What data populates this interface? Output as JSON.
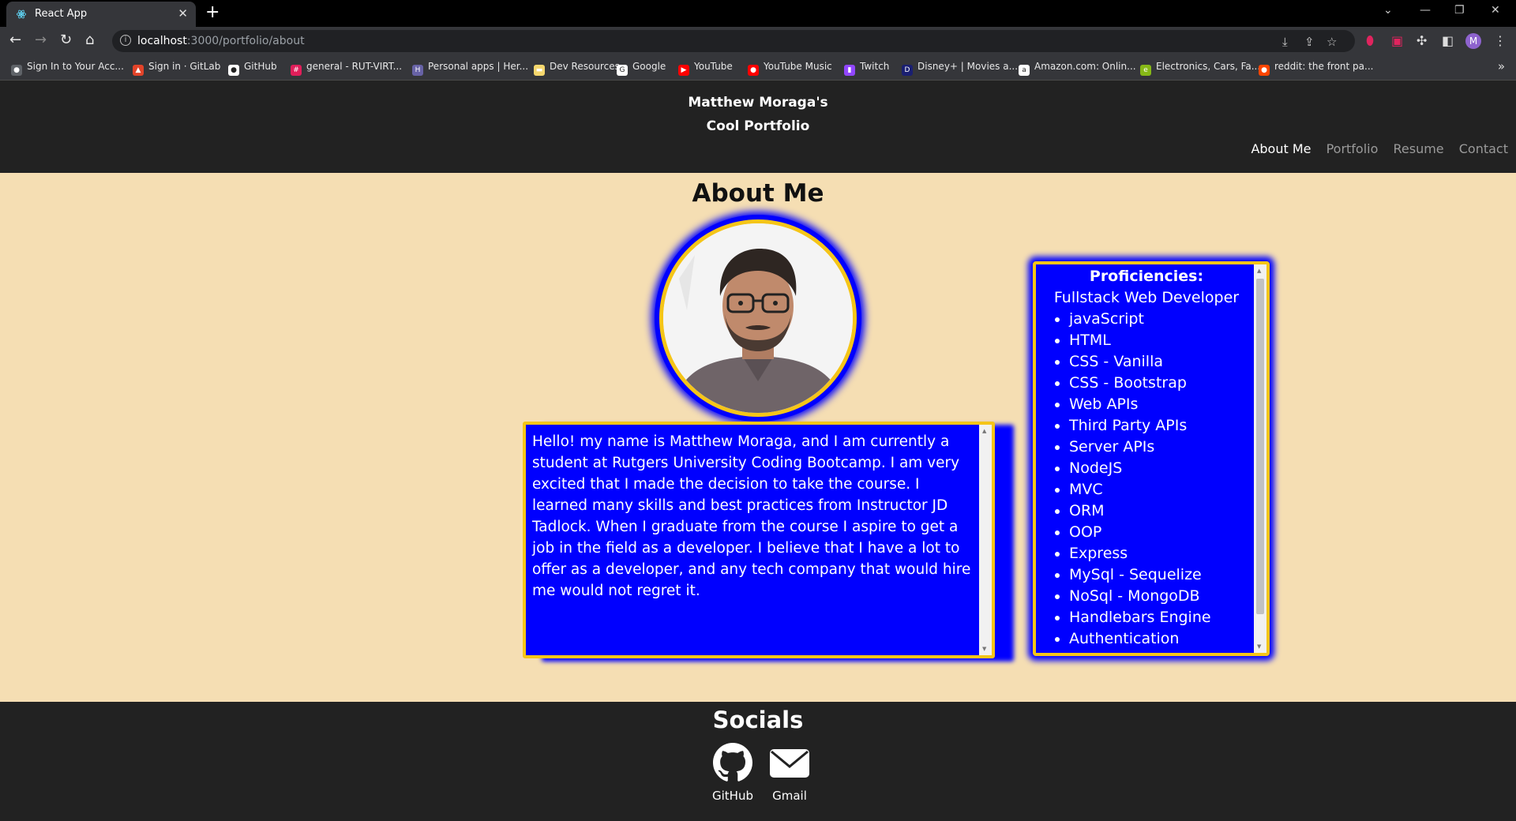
{
  "browser": {
    "tab_title": "React App",
    "url_host": "localhost",
    "url_rest": ":3000/portfolio/about",
    "bookmarks": [
      {
        "label": "Sign In to Your Acc...",
        "icon": "circle-icon",
        "color": "#5f6368"
      },
      {
        "label": "Sign in · GitLab",
        "icon": "gitlab-icon",
        "color": "#e24329"
      },
      {
        "label": "GitHub",
        "icon": "github-icon",
        "color": "#ffffff"
      },
      {
        "label": "general - RUT-VIRT...",
        "icon": "slack-icon",
        "color": "#e01e5a"
      },
      {
        "label": "Personal apps | Her...",
        "icon": "heroku-icon",
        "color": "#6762a6"
      },
      {
        "label": "Dev Resources",
        "icon": "folder-icon",
        "color": "#f5d76e"
      },
      {
        "label": "Google",
        "icon": "google-icon",
        "color": "#ffffff"
      },
      {
        "label": "YouTube",
        "icon": "youtube-icon",
        "color": "#ff0000"
      },
      {
        "label": "YouTube Music",
        "icon": "youtube-music-icon",
        "color": "#ff0000"
      },
      {
        "label": "Twitch",
        "icon": "twitch-icon",
        "color": "#9146ff"
      },
      {
        "label": "Disney+ | Movies a...",
        "icon": "disney-icon",
        "color": "#1a1f71"
      },
      {
        "label": "Amazon.com: Onlin...",
        "icon": "amazon-icon",
        "color": "#ffffff"
      },
      {
        "label": "Electronics, Cars, Fa...",
        "icon": "ebay-icon",
        "color": "#86b817"
      },
      {
        "label": "reddit: the front pa...",
        "icon": "reddit-icon",
        "color": "#ff4500"
      }
    ],
    "avatar_letter": "M"
  },
  "header": {
    "brand_line1": "Matthew Moraga's",
    "brand_line2": "Cool Portfolio",
    "nav": [
      "About Me",
      "Portfolio",
      "Resume",
      "Contact"
    ]
  },
  "main": {
    "title": "About Me",
    "about_text": "Hello! my name is Matthew Moraga, and I am currently a student at Rutgers University Coding Bootcamp. I am very excited that I made the decision to take the course. I learned many skills and best practices from Instructor JD Tadlock. When I graduate from the course I aspire to get a job in the field as a developer. I believe that I have a lot to offer as a developer, and any tech company that would hire me would not regret it.",
    "proficiencies_title": "Proficiencies:",
    "proficiencies_subtitle": "Fullstack Web Developer",
    "proficiencies": [
      "javaScript",
      "HTML",
      "CSS - Vanilla",
      "CSS - Bootstrap",
      "Web APIs",
      "Third Party APIs",
      "Server APIs",
      "NodeJS",
      "MVC",
      "ORM",
      "OOP",
      "Express",
      "MySql - Sequelize",
      "NoSql - MongoDB",
      "Handlebars Engine",
      "Authentication"
    ]
  },
  "footer": {
    "title": "Socials",
    "links": [
      {
        "label": "GitHub",
        "icon": "github-icon"
      },
      {
        "label": "Gmail",
        "icon": "envelope-icon"
      }
    ]
  },
  "colors": {
    "page_bg": "#f5deb3",
    "box_bg": "#0000ff",
    "box_border": "#f5c518",
    "header_bg": "#222222"
  }
}
